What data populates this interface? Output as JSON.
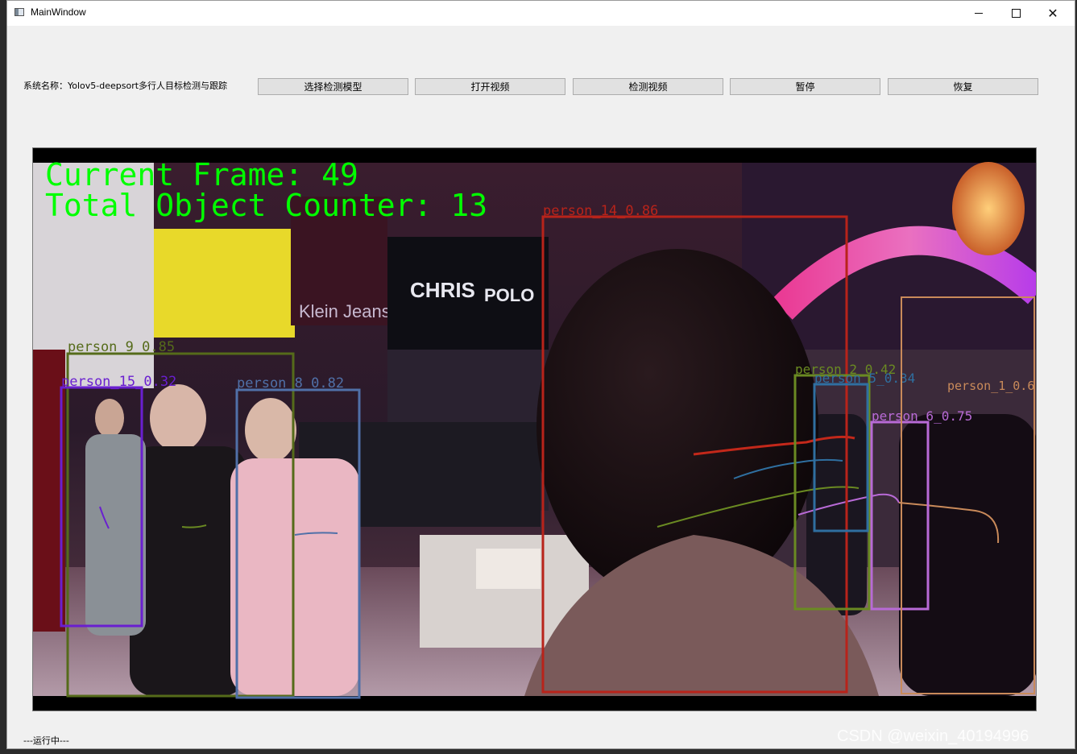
{
  "window": {
    "title": "MainWindow"
  },
  "toolbar": {
    "system_label": "系统名称：Yolov5-deepsort多行人目标检测与跟踪",
    "buttons": [
      {
        "label": "选择检测模型"
      },
      {
        "label": "打开视频"
      },
      {
        "label": "检测视频"
      },
      {
        "label": "暂停"
      },
      {
        "label": "恢复"
      }
    ]
  },
  "video": {
    "overlay_frame": "Current Frame: 49",
    "overlay_counter": "Total Object Counter: 13",
    "overlay_color": "#00ff00",
    "scene_signs": {
      "brand_1": "CHRIS",
      "brand_2": "POLO",
      "brand_3": "Klein Jeans"
    },
    "detections": [
      {
        "label": "person_9_0.85",
        "color": "#556b1a"
      },
      {
        "label": "person_15_0.32",
        "color": "#6a1fd0"
      },
      {
        "label": "person_8_0.82",
        "color": "#5070a8"
      },
      {
        "label": "person_14_0.86",
        "color": "#b8231a"
      },
      {
        "label": "person_2_0.42",
        "color": "#6a8a22"
      },
      {
        "label": "person_5_0.34",
        "color": "#2f6fa0"
      },
      {
        "label": "person_6_0.75",
        "color": "#b86ad6"
      },
      {
        "label": "person_1_0.6",
        "color": "#c98a5a"
      }
    ]
  },
  "statusbar": {
    "text": "---运行中---"
  },
  "watermark": "CSDN @weixin_40194996"
}
